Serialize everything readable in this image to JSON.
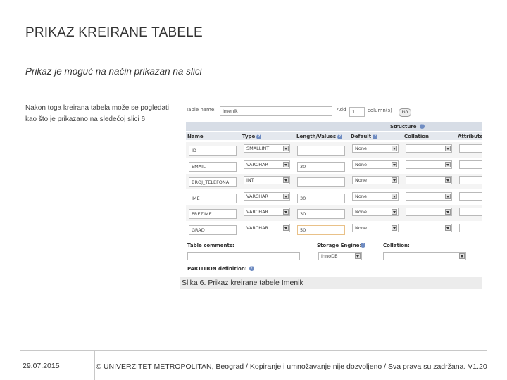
{
  "slide": {
    "title": "PRIKAZ KREIRANE TABELE",
    "subtitle": "Prikaz je moguć na način prikazan na slici",
    "body": "Nakon toga kreirana tabela može se pogledati kao što je prikazano na sledećoj slici 6."
  },
  "screenshot": {
    "table_name_label": "Table name:",
    "table_name_value": "imenik",
    "add_label": "Add",
    "add_value": "1",
    "columns_label": "column(s)",
    "go_button": "Go",
    "structure_label": "Structure",
    "columns": [
      "Name",
      "Type",
      "Length/Values",
      "Default",
      "Collation",
      "Attribute"
    ],
    "rows": [
      {
        "name": "ID",
        "type": "SMALLINT",
        "length": "",
        "default": "None"
      },
      {
        "name": "EMAIL",
        "type": "VARCHAR",
        "length": "30",
        "default": "None"
      },
      {
        "name": "BROJ_TELEFONA",
        "type": "INT",
        "length": "",
        "default": "None"
      },
      {
        "name": "IME",
        "type": "VARCHAR",
        "length": "30",
        "default": "None"
      },
      {
        "name": "PREZIME",
        "type": "VARCHAR",
        "length": "30",
        "default": "None"
      },
      {
        "name": "GRAD",
        "type": "VARCHAR",
        "length": "50",
        "default": "None"
      }
    ],
    "table_comments_label": "Table comments:",
    "storage_engine_label": "Storage Engine:",
    "storage_engine_value": "InnoDB",
    "collation_label": "Collation:",
    "partition_label": "PARTITION definition:"
  },
  "caption": "Slika 6. Prikaz kreirane tabele Imenik",
  "footer": {
    "date": "29.07.2015",
    "copyright": "© UNIVERZITET METROPOLITAN, Beograd / Kopiranje i umnožavanje nije dozvoljeno / Sva prava su zadržana. V1.20"
  }
}
